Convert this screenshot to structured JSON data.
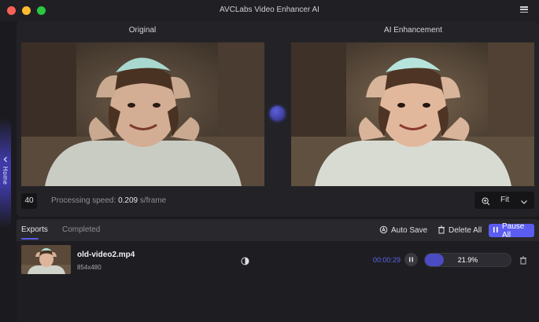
{
  "window": {
    "title": "AVCLabs Video Enhancer AI"
  },
  "sidebar": {
    "home_label": "Home"
  },
  "preview": {
    "original_label": "Original",
    "enhanced_label": "AI Enhancement",
    "frame_count": "40",
    "speed_label": "Processing speed:",
    "speed_value": "0.209",
    "speed_unit": "s/frame",
    "zoom_value": "Fit"
  },
  "queue": {
    "tabs": [
      {
        "label": "Exports",
        "active": true
      },
      {
        "label": "Completed",
        "active": false
      }
    ],
    "auto_save_label": "Auto Save",
    "delete_all_label": "Delete All",
    "pause_all_label": "Pause All",
    "items": [
      {
        "filename": "old-video2.mp4",
        "resolution": "854x480",
        "elapsed": "00:00:29",
        "progress": 0.219,
        "progress_label": "21.9%"
      }
    ]
  },
  "colors": {
    "accent": "#5b5cf0",
    "progress_fill": "#4b4cc2",
    "elapsed_text": "#5e63e8"
  }
}
